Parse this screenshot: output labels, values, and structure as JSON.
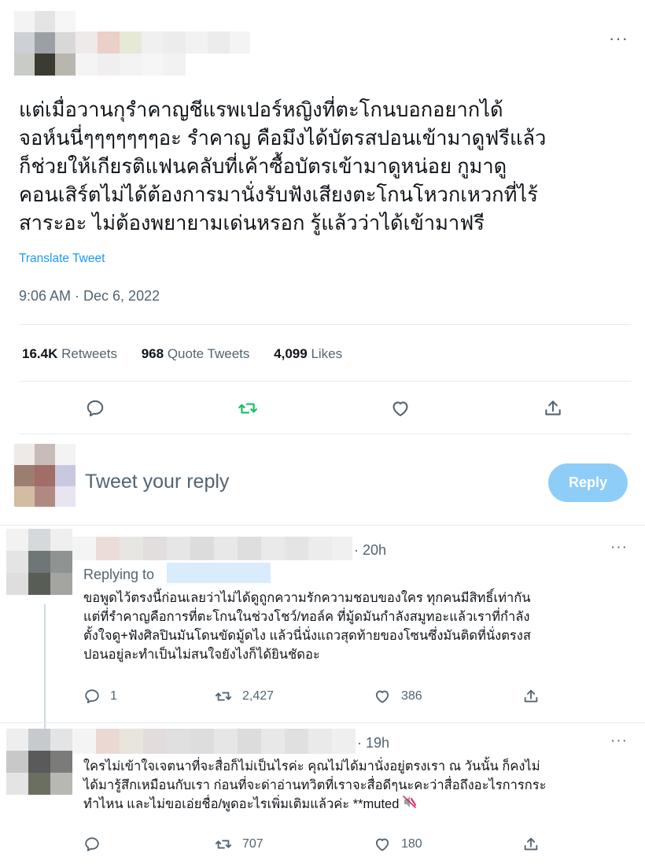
{
  "tweet": {
    "more_icon": "more-icon",
    "text_lines": [
      "แต่เมื่อวานกุรำคาญชีแรพเปอร์หญิงที่ตะโกนบอกอยากได้",
      "จอห์นนี่ๆๆๆๆๆๆๆอะ รำคาญ คือมึงได้บัตรสปอนเข้ามาดูฟรีแล้ว",
      "ก็ช่วยให้เกียรติแฟนคลับที่เค้าซื้อบัตรเข้ามาดูหน่อย กูมาดู",
      "คอนเสิร์ตไม่ได้ต้องการมานั่งรับฟังเสียงตะโกนโหวกเหวกที่ไร้",
      "สาระอะ ไม่ต้องพยายามเด่นหรอก รู้แล้วว่าได้เข้ามาฟรี"
    ],
    "translate_label": "Translate Tweet",
    "timestamp": "9:06 AM · Dec 6, 2022",
    "stats": {
      "retweets_count": "16.4K",
      "retweets_label": "Retweets",
      "quotes_count": "968",
      "quotes_label": "Quote Tweets",
      "likes_count": "4,099",
      "likes_label": "Likes"
    },
    "actions": [
      "reply-icon",
      "retweet-icon",
      "like-icon",
      "share-icon"
    ],
    "accent_color": "#17bf63"
  },
  "compose": {
    "placeholder": "Tweet your reply",
    "reply_button": "Reply",
    "button_color": "#8ecdf8"
  },
  "replies": [
    {
      "time": "· 20h",
      "replying_to": "Replying to",
      "text_lines": [
        "ขอพูดไว้ตรงนี้ก่อนเลยว่าไม่ได้ดูถูกความรักความชอบของใคร ทุกคนมีสิทธิ์เท่ากัน",
        "แต่ที่รำคาญคือการที่ตะโกนในช่วงโชว์/ทอล์ค ที่มู้ดมันกำลังสมูทอะแล้วเราที่กำลัง",
        "ตั้งใจดู+ฟังศิลปินมันโดนขัดมู้ดไง แล้วนี่นั่งแถวสุดท้ายของโซนซึ่งมันติดที่นั่งตรงส",
        "ปอนอยู่ละทำเป็นไม่สนใจยังไงก็ได้ยินชัดอะ"
      ],
      "reply_count": "1",
      "retweet_count": "2,427",
      "like_count": "386"
    },
    {
      "time": "· 19h",
      "text_lines": [
        "ใครไม่เข้าใจเจตนาที่จะสื่อก็ไม่เป็นไรค่ะ คุณไม่ได้มานั่งอยู่ตรงเรา ณ วันนั้น ก็คงไม่",
        "ได้มารู้สึกเหมือนกับเรา ก่อนที่จะด่าอ่านทวิตที่เราจะสื่อดีๆนะคะว่าสื่อถึงอะไรการกระ",
        "ทำไหน และไม่ขอเอ่ยชื่อ/พูดอะไรเพิ่มเติมแล้วค่ะ **muted"
      ],
      "retweet_count": "707",
      "like_count": "180"
    }
  ]
}
